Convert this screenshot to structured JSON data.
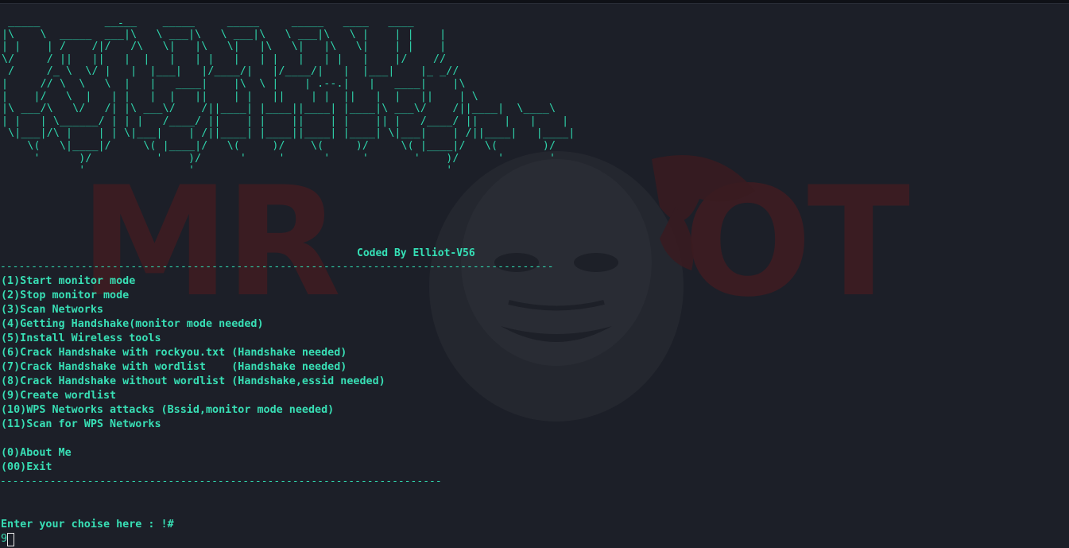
{
  "terminal": {
    "banner_ascii": " _____          _____    _____     _____     _____   ____   ____\n|\\    \\  _____  ___|\\   \\ ___|\\   \\ ___|\\   \\ ___|\\   \\ |    | |    |\n| |    | /    /|/   /\\   \\|   |\\   \\|   |\\   \\|   |\\   \\|    | |    |\n\\/     / ||   ||   |  |   |   | |   |   | |   |   | |   |    |/    //\n /     /_ \\  \\/ |   |  |___|   |/____/|   |/____/|   |  |___|    |_ _//\n|     // \\  \\   \\  |   |   ____|    |\\  \\ |    | .--.|   |   ____|    |\\\n|    |/   \\  |   | |   |  |   ||    | |   ||    | |  ||   |  |   ||    | \\\n|\\ ___/\\   \\/   /| |\\ ___\\/    /||____| |____||____| |____|\\ ___\\/    /||____|  \\____\\\n| |   | \\______/ | | |   /____/ ||    | |    ||    | |    || |   /____/ ||    |   |    |\n \\|___|/\\ |    | | \\|___|    | /||____| |____||____| |____| \\|___|    | /||____|   |____|\n    \\(   \\|____|/     \\( |____|/   \\(     )/    \\(     )/     \\( |____|/   \\(       )/\n     '      )/          '    )/      '     '      '     '       '    )/      '       '\n            '                '                                       '",
    "cursor_mark": "-",
    "coded_by": "Coded By Elliot-V56",
    "rule_top": "------------------------------------------------------------------------------------------",
    "menu": [
      "(1)Start monitor mode",
      "(2)Stop monitor mode",
      "(3)Scan Networks",
      "(4)Getting Handshake(monitor mode needed)",
      "(5)Install Wireless tools",
      "(6)Crack Handshake with rockyou.txt (Handshake needed)",
      "(7)Crack Handshake with wordlist    (Handshake needed)",
      "(8)Crack Handshake without wordlist (Handshake,essid needed)",
      "(9)Create wordlist",
      "(10)WPS Networks attacks (Bssid,monitor mode needed)",
      "(11)Scan for WPS Networks",
      "",
      "(0)About Me",
      "(00)Exit"
    ],
    "rule_bottom": "-----------------------------------------------------------------------",
    "prompt": "Enter your choise here : !#",
    "input_value": "9"
  },
  "wallpaper": {
    "text": "MR ROBOT",
    "text_color": "#4a1a22",
    "mask_color": "#3a3d44"
  },
  "colors": {
    "background": "#1c1f28",
    "accent": "#2fd6ad"
  }
}
